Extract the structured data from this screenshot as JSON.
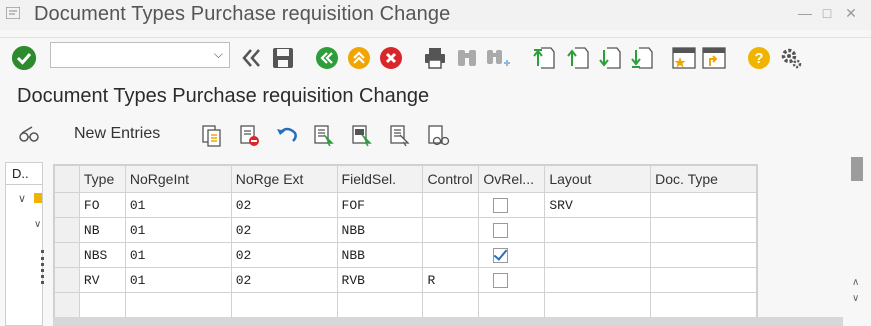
{
  "window": {
    "title": "Document Types Purchase requisition Change"
  },
  "toolbar": {
    "command_placeholder": ""
  },
  "screen": {
    "title": "Document Types Purchase requisition Change"
  },
  "appbar": {
    "new_entries": "New Entries"
  },
  "leftpane": {
    "header": "D.."
  },
  "table": {
    "columns": [
      "Type",
      "NoRgeInt",
      "NoRge Ext",
      "FieldSel.",
      "Control",
      "OvRel...",
      "Layout",
      "Doc. Type"
    ],
    "rows": [
      {
        "type": "FO",
        "int": "01",
        "ext": "02",
        "field": "FOF",
        "control": "",
        "ovrel": false,
        "layout": "SRV",
        "doctype": ""
      },
      {
        "type": "NB",
        "int": "01",
        "ext": "02",
        "field": "NBB",
        "control": "",
        "ovrel": false,
        "layout": "",
        "doctype": ""
      },
      {
        "type": "NBS",
        "int": "01",
        "ext": "02",
        "field": "NBB",
        "control": "",
        "ovrel": true,
        "layout": "",
        "doctype": ""
      },
      {
        "type": "RV",
        "int": "01",
        "ext": "02",
        "field": "RVB",
        "control": "R",
        "ovrel": false,
        "layout": "",
        "doctype": ""
      }
    ]
  },
  "colors": {
    "ok": "#2d8a2d",
    "nav_green": "#2e9e3a",
    "orange": "#f0a500",
    "cancel_red": "#d9262a",
    "help": "#f0b400",
    "check_blue": "#2a6ebb"
  }
}
